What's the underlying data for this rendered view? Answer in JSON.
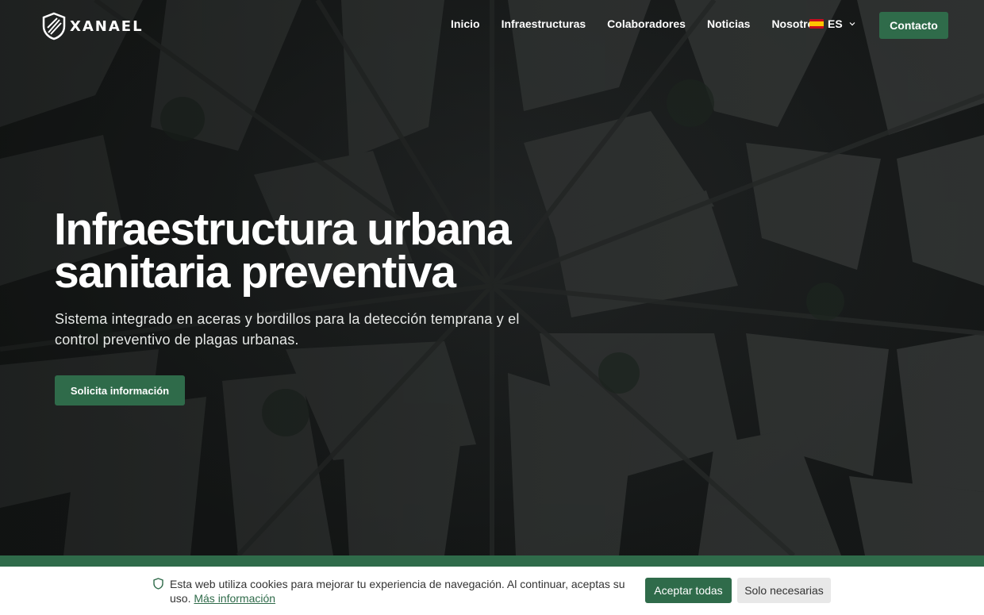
{
  "brand": {
    "name": "XANAEL"
  },
  "nav": {
    "links": [
      "Inicio",
      "Infraestructuras",
      "Colaboradores",
      "Noticias",
      "Nosotros"
    ],
    "language": "ES",
    "contact_label": "Contacto"
  },
  "hero": {
    "title_line1": "Infraestructura urbana",
    "title_line2": "sanitaria preventiva",
    "subtitle": "Sistema integrado en aceras y bordillos para la detección temprana y el control preventivo de plagas urbanas.",
    "cta_label": "Solicita información"
  },
  "cookie": {
    "text": "Esta web utiliza cookies para mejorar tu experiencia de navegación. Al continuar, aceptas su uso.",
    "link": "Más información",
    "accept_label": "Aceptar todas",
    "necessary_label": "Solo necesarias"
  },
  "icons": {
    "shield": "shield-icon",
    "logo": "logo-shield-icon",
    "flag": "spain-flag-icon",
    "chevron": "chevron-down-icon"
  },
  "colors": {
    "accent": "#2f6b4a",
    "hero_bg": "#26292a",
    "cookie_bg": "#ffffff"
  }
}
